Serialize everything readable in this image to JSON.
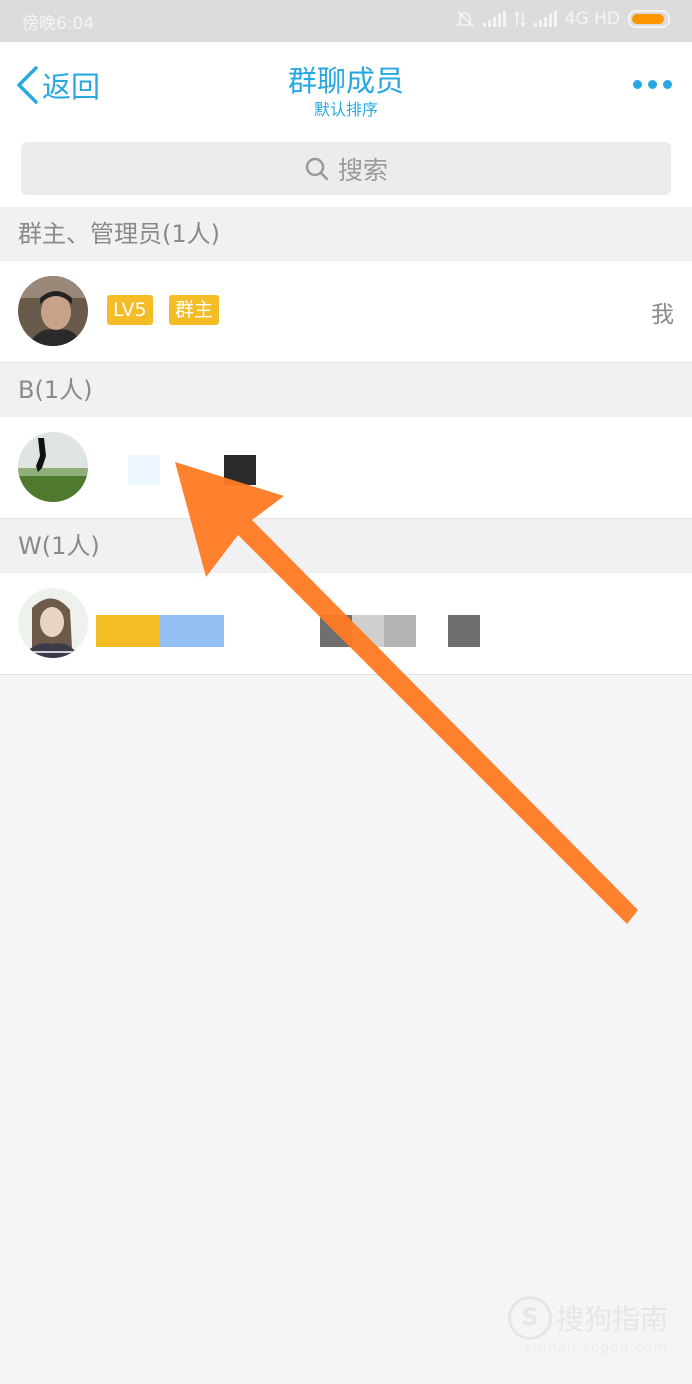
{
  "status_bar": {
    "time": "傍晚6:04",
    "network": "4G HD",
    "battery_color": "#ff9500"
  },
  "nav": {
    "back_label": "返回",
    "title": "群聊成员",
    "subtitle": "默认排序",
    "accent_color": "#28a8e0"
  },
  "search": {
    "placeholder": "搜索"
  },
  "sections": [
    {
      "header": "群主、管理员(1人)",
      "members": [
        {
          "badges": [
            "LV5",
            "群主"
          ],
          "right_label": "我"
        }
      ]
    },
    {
      "header": "B(1人)",
      "members": [
        {}
      ]
    },
    {
      "header": "W(1人)",
      "members": [
        {}
      ]
    }
  ],
  "annotation": {
    "arrow_color": "#ff7a22"
  },
  "watermark": {
    "logo": "S",
    "text": "搜狗指南",
    "sub": "zhinan.sogou.com"
  }
}
